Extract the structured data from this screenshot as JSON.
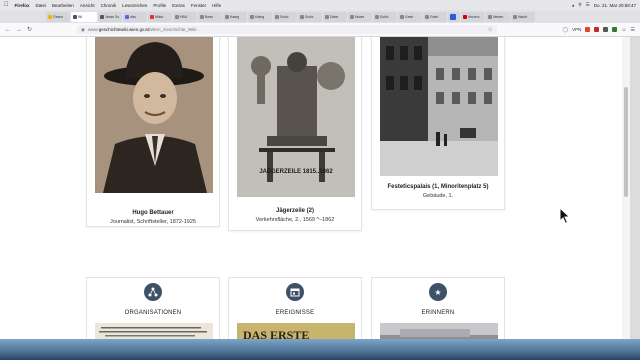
{
  "menubar": {
    "app": "Firefox",
    "items": [
      "Datei",
      "Bearbeiten",
      "Ansicht",
      "Chronik",
      "Lesezeichen",
      "Profile",
      "Extras",
      "Fenster",
      "Hilfe"
    ],
    "clock": "Do. 21. Mar 20:58:47"
  },
  "tabs": [
    {
      "label": "Gesch"
    },
    {
      "label": "Wi"
    },
    {
      "label": "Jesse Zu"
    },
    {
      "label": "disc"
    },
    {
      "label": "Mitch"
    },
    {
      "label": "HBU"
    },
    {
      "label": "Beari"
    },
    {
      "label": "Kateg"
    },
    {
      "label": "Kateg"
    },
    {
      "label": "Schic"
    },
    {
      "label": "Schic"
    },
    {
      "label": "Datei"
    },
    {
      "label": "Notes"
    },
    {
      "label": "Schic"
    },
    {
      "label": "Gesh"
    },
    {
      "label": "Gesh"
    },
    {
      "label": ""
    },
    {
      "label": "Verzeic"
    },
    {
      "label": "Neben"
    },
    {
      "label": "Nachr"
    }
  ],
  "url": {
    "prefix": "www.",
    "host": "geschichtewiki.wien.gv.at",
    "path": "/Wien_Geschichte_Wiki"
  },
  "toolbar": {
    "vpn_label": "VPN"
  },
  "cards": [
    {
      "title": "Hugo Bettauer",
      "subtitle": "Journalist, Schriftsteller, 1872-1925"
    },
    {
      "title": "Jägerzeile (2)",
      "subtitle": "Verkehrsfläche, 2., 1569 ^–1862",
      "image_text": "JAEGERZEILE 1815..1862"
    },
    {
      "title": "Festeticspalais (1, Minoritenplatz 5)",
      "subtitle": "Gebäude, 1."
    }
  ],
  "categories": [
    {
      "label": "ORGANISATIONEN",
      "icon": "network-icon"
    },
    {
      "label": "EREIGNISSE",
      "icon": "calendar-icon",
      "thumb_text": "DAS ERSTE"
    },
    {
      "label": "ERINNERN",
      "icon": "star-icon"
    }
  ],
  "colors": {
    "accent": "#3e5168"
  }
}
